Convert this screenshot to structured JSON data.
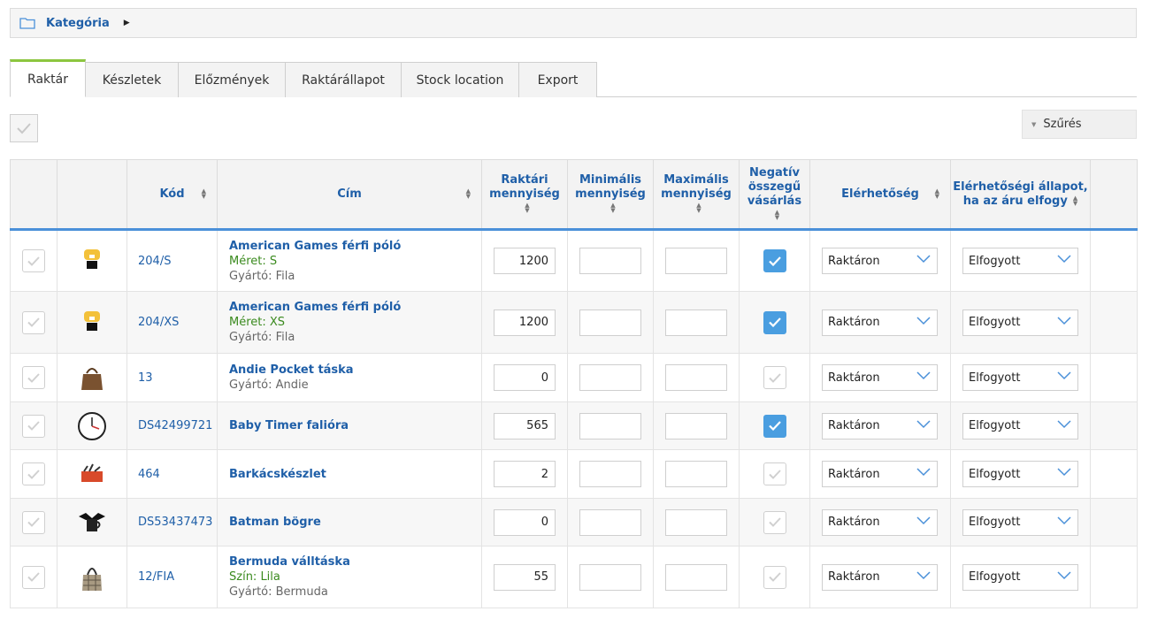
{
  "breadcrumb": {
    "title": "Kategória"
  },
  "tabs": [
    {
      "label": "Raktár",
      "active": true
    },
    {
      "label": "Készletek",
      "active": false
    },
    {
      "label": "Előzmények",
      "active": false
    },
    {
      "label": "Raktárállapot",
      "active": false
    },
    {
      "label": "Stock location",
      "active": false
    },
    {
      "label": "Export",
      "active": false
    }
  ],
  "filter": {
    "label": "Szűrés"
  },
  "columns": {
    "code": "Kód",
    "title": "Cím",
    "stock_l1": "Raktári",
    "stock_l2": "mennyiség",
    "min_l1": "Minimális",
    "min_l2": "mennyiség",
    "max_l1": "Maximális",
    "max_l2": "mennyiség",
    "neg_l1": "Negatív",
    "neg_l2": "összegű",
    "neg_l3": "vásárlás",
    "avail": "Elérhetőség",
    "oos_l1": "Elérhetőségi állapot,",
    "oos_l2": "ha az áru elfogy"
  },
  "colors": {
    "accent": "#1f5fa8",
    "tab_active": "#8cc63f",
    "checkbox_on": "#4a9ee0",
    "variant": "#3a8a1e"
  },
  "rows": [
    {
      "code": "204/S",
      "title": "American Games férfi póló",
      "variant": "Méret: S",
      "maker": "Gyártó: Fila",
      "stock": "1200",
      "min": "",
      "max": "",
      "negative": true,
      "availability": "Raktáron",
      "oos_status": "Elfogyott",
      "image": "tshirt-icon"
    },
    {
      "code": "204/XS",
      "title": "American Games férfi póló",
      "variant": "Méret: XS",
      "maker": "Gyártó: Fila",
      "stock": "1200",
      "min": "",
      "max": "",
      "negative": true,
      "availability": "Raktáron",
      "oos_status": "Elfogyott",
      "image": "tshirt-icon"
    },
    {
      "code": "13",
      "title": "Andie Pocket táska",
      "variant": "",
      "maker": "Gyártó: Andie",
      "stock": "0",
      "min": "",
      "max": "",
      "negative": false,
      "availability": "Raktáron",
      "oos_status": "Elfogyott",
      "image": "handbag-icon"
    },
    {
      "code": "DS42499721",
      "title": "Baby Timer falióra",
      "variant": "",
      "maker": "",
      "stock": "565",
      "min": "",
      "max": "",
      "negative": true,
      "availability": "Raktáron",
      "oos_status": "Elfogyott",
      "image": "clock-icon"
    },
    {
      "code": "464",
      "title": "Barkácskészlet",
      "variant": "",
      "maker": "",
      "stock": "2",
      "min": "",
      "max": "",
      "negative": false,
      "availability": "Raktáron",
      "oos_status": "Elfogyott",
      "image": "toolbox-icon"
    },
    {
      "code": "DS53437473",
      "title": "Batman bögre",
      "variant": "",
      "maker": "",
      "stock": "0",
      "min": "",
      "max": "",
      "negative": false,
      "availability": "Raktáron",
      "oos_status": "Elfogyott",
      "image": "mug-icon"
    },
    {
      "code": "12/FIA",
      "title": "Bermuda válltáska",
      "variant": "Szín: Lila",
      "maker": "Gyártó: Bermuda",
      "stock": "55",
      "min": "",
      "max": "",
      "negative": false,
      "availability": "Raktáron",
      "oos_status": "Elfogyott",
      "image": "shoulder-bag-icon"
    }
  ]
}
